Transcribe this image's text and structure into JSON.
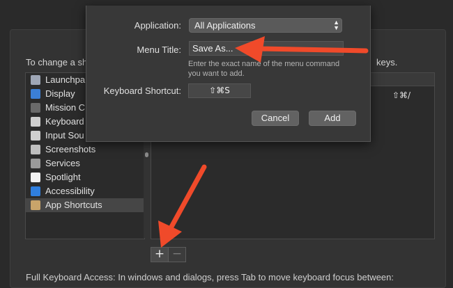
{
  "background": {
    "instruction_left": "To change a sh",
    "instruction_right": "keys.",
    "categories": [
      {
        "label": "Launchpa",
        "icon": "launchpad-icon",
        "color": "#9ea6b5"
      },
      {
        "label": "Display",
        "icon": "display-icon",
        "color": "#3b7fd6"
      },
      {
        "label": "Mission C",
        "icon": "mission-control-icon",
        "color": "#6a6a6a"
      },
      {
        "label": "Keyboard",
        "icon": "keyboard-icon",
        "color": "#cfcfcf"
      },
      {
        "label": "Input Sou",
        "icon": "input-sources-icon",
        "color": "#cfcfcf"
      },
      {
        "label": "Screenshots",
        "icon": "screenshot-icon",
        "color": "#bfbfbf"
      },
      {
        "label": "Services",
        "icon": "gear-icon",
        "color": "#9a9a9a"
      },
      {
        "label": "Spotlight",
        "icon": "spotlight-icon",
        "color": "#f2f2f2"
      },
      {
        "label": "Accessibility",
        "icon": "accessibility-icon",
        "color": "#2f7fe0"
      },
      {
        "label": "App Shortcuts",
        "icon": "app-shortcuts-icon",
        "color": "#c9a46a",
        "selected": true
      }
    ],
    "table_shortcut": "⇧⌘/",
    "add_label": "+",
    "remove_label": "−",
    "footer": "Full Keyboard Access: In windows and dialogs, press Tab to move keyboard focus between:"
  },
  "dialog": {
    "application_label": "Application:",
    "application_value": "All Applications",
    "menu_title_label": "Menu Title:",
    "menu_title_value": "Save As...",
    "hint_line1": "Enter the exact name of the menu command",
    "hint_line2": "you want to add.",
    "shortcut_label": "Keyboard Shortcut:",
    "shortcut_value": "⇧⌘S",
    "cancel_label": "Cancel",
    "add_label": "Add"
  },
  "annotations": {
    "arrow_color": "#f04a2a"
  }
}
